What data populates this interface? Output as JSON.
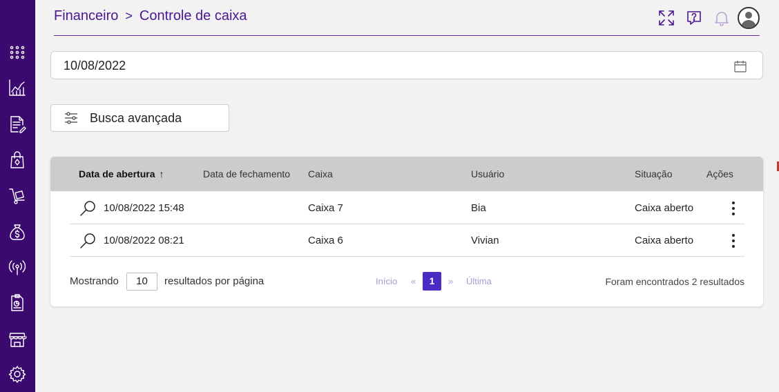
{
  "colors": {
    "sidebar": "#3b0a6e",
    "accent": "#4a1790",
    "pager_current": "#4b2bc4",
    "pager_muted": "#a99bd1",
    "table_header": "#cccccc"
  },
  "sidebar": {
    "items": [
      {
        "icon": "apps-grid-icon"
      },
      {
        "icon": "chart-icon"
      },
      {
        "icon": "document-edit-icon"
      },
      {
        "icon": "shopping-bag-icon"
      },
      {
        "icon": "cart-dolly-icon"
      },
      {
        "icon": "money-bag-icon"
      },
      {
        "icon": "broadcast-icon"
      },
      {
        "icon": "report-icon"
      },
      {
        "icon": "store-icon"
      },
      {
        "icon": "gear-icon"
      }
    ]
  },
  "breadcrumb": {
    "parent": "Financeiro",
    "separator": ">",
    "current": "Controle de caixa"
  },
  "header_tools": {
    "icons": [
      "fullscreen-icon",
      "help-chat-icon",
      "bell-icon",
      "user-avatar-icon"
    ]
  },
  "date_filter": {
    "value": "10/08/2022"
  },
  "advanced_search": {
    "label": "Busca avançada"
  },
  "table": {
    "columns": {
      "opened": "Data de abertura",
      "closed": "Data de fechamento",
      "register": "Caixa",
      "user": "Usuário",
      "status": "Situação",
      "actions": "Ações"
    },
    "sort_arrow": "↑",
    "rows": [
      {
        "opened": "10/08/2022 15:48",
        "closed": "",
        "register": "Caixa 7",
        "user": "Bia",
        "status": "Caixa aberto"
      },
      {
        "opened": "10/08/2022 08:21",
        "closed": "",
        "register": "Caixa 6",
        "user": "Vivian",
        "status": "Caixa aberto"
      }
    ]
  },
  "pagination": {
    "showing_label": "Mostrando",
    "page_size": "10",
    "per_page_label": "resultados por página",
    "first": "Início",
    "prev": "«",
    "current": "1",
    "next": "»",
    "last": "Última",
    "results_text": "Foram encontrados 2 resultados"
  }
}
